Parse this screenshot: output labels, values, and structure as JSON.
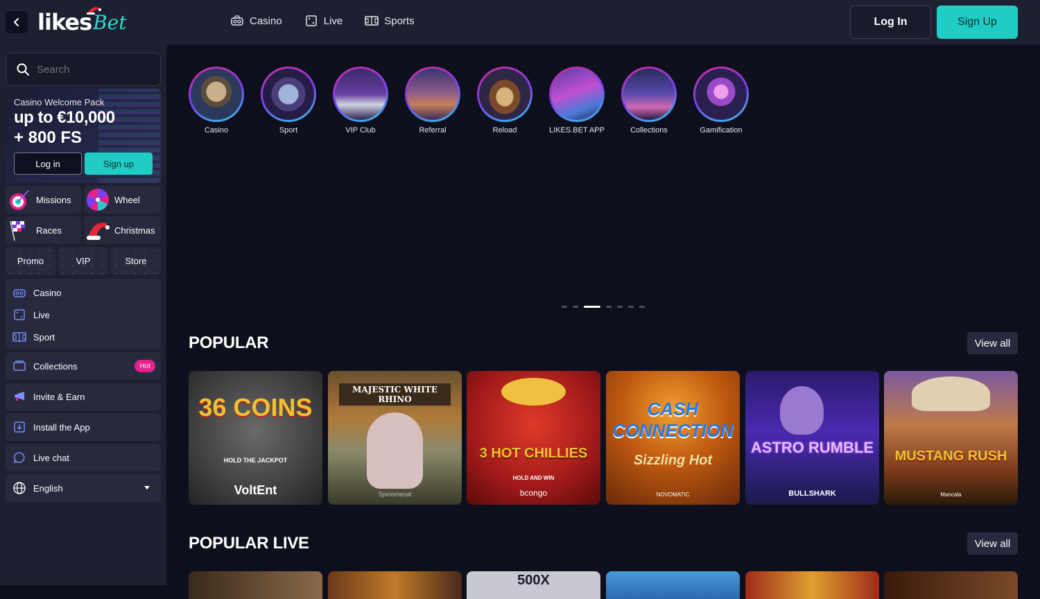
{
  "header": {
    "logo_main": "likes",
    "logo_accent": "Bet",
    "nav": [
      {
        "label": "Casino",
        "icon": "casino-icon"
      },
      {
        "label": "Live",
        "icon": "dice-icon"
      },
      {
        "label": "Sports",
        "icon": "sports-field-icon"
      }
    ],
    "login_label": "Log In",
    "signup_label": "Sign Up"
  },
  "sidebar": {
    "search_placeholder": "Search",
    "promo": {
      "kicker": "Casino Welcome Pack",
      "line1": "up to €10,000",
      "line2": "+ 800 FS",
      "login_label": "Log in",
      "signup_label": "Sign up"
    },
    "tiles": [
      {
        "label": "Missions",
        "icon": "target-icon"
      },
      {
        "label": "Wheel",
        "icon": "wheel-icon"
      },
      {
        "label": "Races",
        "icon": "checkered-flag-icon"
      },
      {
        "label": "Christmas",
        "icon": "santa-hat-icon"
      }
    ],
    "pills": [
      "Promo",
      "VIP",
      "Store"
    ],
    "menu": [
      {
        "label": "Casino",
        "icon": "casino-icon"
      },
      {
        "label": "Live",
        "icon": "dice-icon"
      },
      {
        "label": "Sport",
        "icon": "sports-field-icon"
      }
    ],
    "collections_label": "Collections",
    "hot_badge": "Hot",
    "invite_label": "Invite & Earn",
    "install_label": "Install the App",
    "chat_label": "Live chat",
    "language_label": "English"
  },
  "categories": [
    {
      "label": "Casino"
    },
    {
      "label": "Sport"
    },
    {
      "label": "VIP Club"
    },
    {
      "label": "Referral"
    },
    {
      "label": "Reload"
    },
    {
      "label": "LIKES.BET APP"
    },
    {
      "label": "Collections"
    },
    {
      "label": "Gamification"
    }
  ],
  "carousel": {
    "count": 8,
    "active_index": 2
  },
  "popular": {
    "title": "POPULAR",
    "view_all": "View all",
    "games": [
      {
        "title": "36 COINS",
        "subtitle": "HOLD THE JACKPOT",
        "provider": "VoltEnt"
      },
      {
        "title": "MAJESTIC WHITE RHINO",
        "subtitle": "",
        "provider": "Spinomenal"
      },
      {
        "title": "3 HOT CHILLIES",
        "subtitle": "HOLD AND WIN",
        "provider": "bcongo"
      },
      {
        "title": "CASH CONNECTION",
        "subtitle": "Sizzling Hot",
        "provider": "NOVOMATIC"
      },
      {
        "title": "ASTRO RUMBLE",
        "subtitle": "",
        "provider": "BULLSHARK"
      },
      {
        "title": "MUSTANG RUSH",
        "subtitle": "",
        "provider": "Mancala"
      }
    ]
  },
  "popular_live": {
    "title": "POPULAR LIVE",
    "view_all": "View all",
    "peek_text": "500X"
  },
  "colors": {
    "accent": "#1fcdc5",
    "hot": "#e8208b",
    "panel": "#1d2030",
    "bg": "#0d0f1c"
  }
}
